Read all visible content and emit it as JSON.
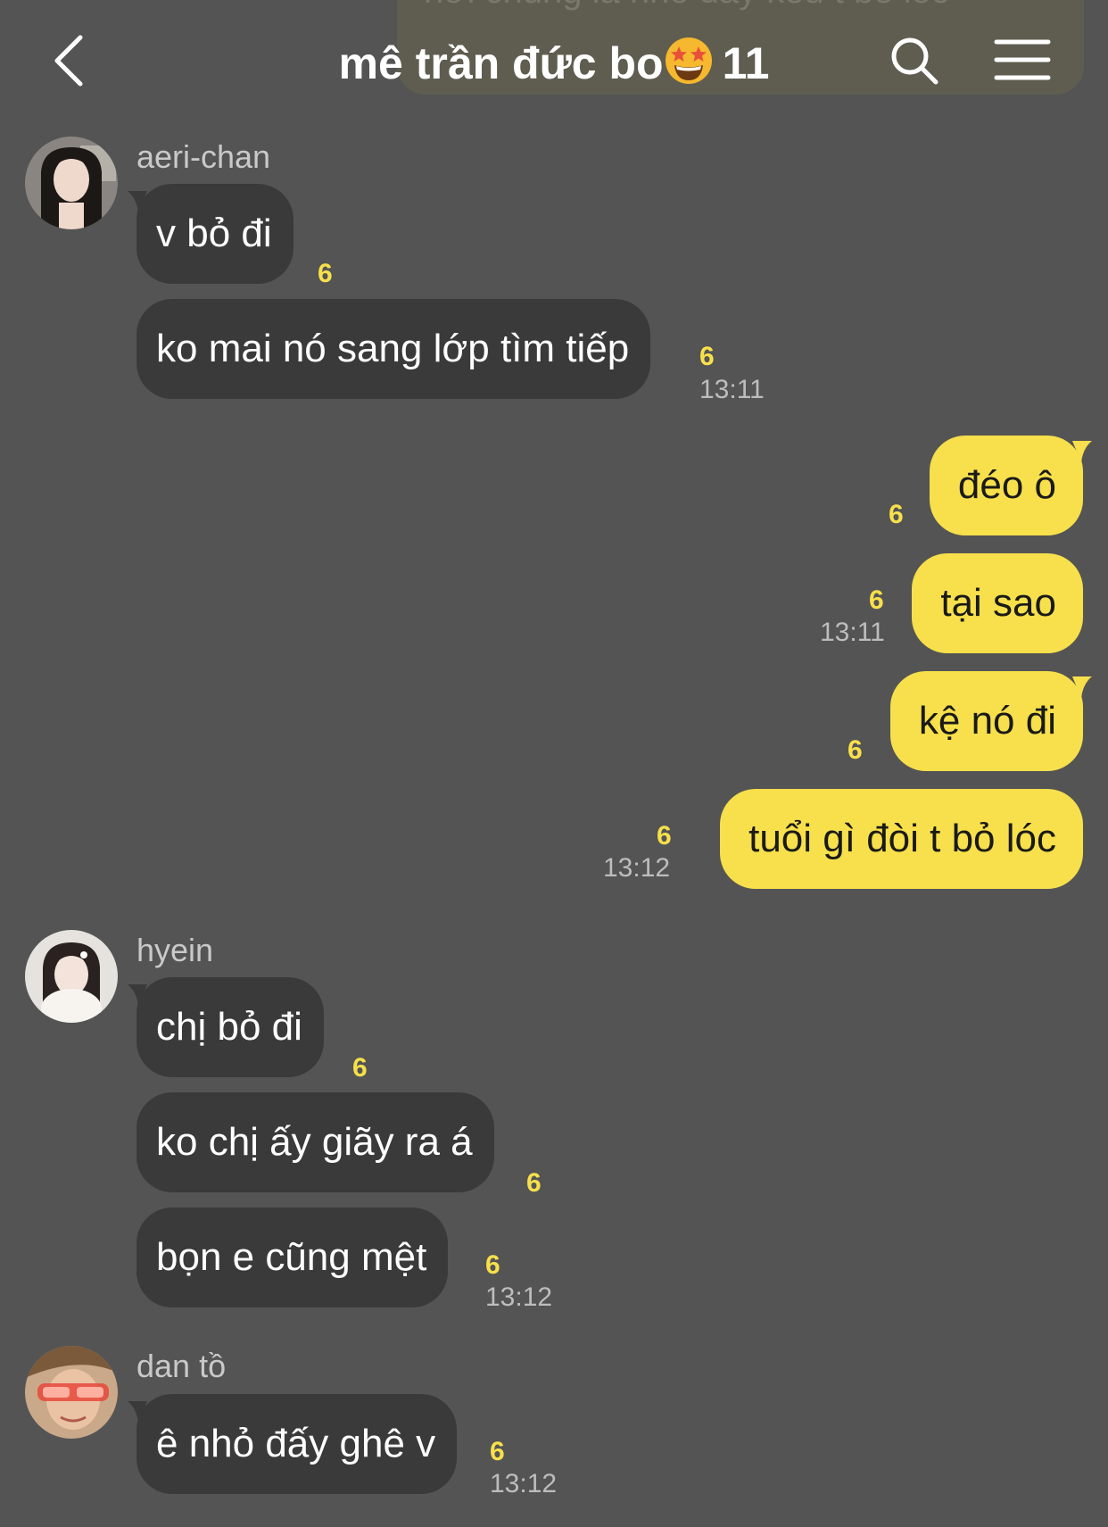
{
  "header": {
    "banner_peek": "hơi chúng là nhỏ đấy kêu t bỏ lóc",
    "title": "mê trần đức bo",
    "member_count": "11",
    "icons": [
      "back-icon",
      "star-struck-emoji",
      "search-icon",
      "menu-icon"
    ]
  },
  "messages": {
    "aeri": {
      "name": "aeri-chan",
      "m1": {
        "text": "v bỏ đi",
        "unread": "6"
      },
      "m2": {
        "text": "ko mai nó sang lớp tìm tiếp",
        "unread": "6",
        "time": "13:11"
      }
    },
    "me": {
      "m1": {
        "text": "đéo ô",
        "unread": "6"
      },
      "m2": {
        "text": "tại sao",
        "unread": "6",
        "time": "13:11"
      },
      "m3": {
        "text": "kệ nó đi",
        "unread": "6"
      },
      "m4": {
        "text": "tuổi gì đòi t bỏ lóc",
        "unread": "6",
        "time": "13:12"
      }
    },
    "hyein": {
      "name": "hyein",
      "m1": {
        "text": "chị bỏ đi",
        "unread": "6"
      },
      "m2": {
        "text": "ko chị ấy giãy ra á",
        "unread": "6"
      },
      "m3": {
        "text": "bọn e cũng mệt",
        "unread": "6",
        "time": "13:12"
      }
    },
    "dan": {
      "name": "dan tồ",
      "m1": {
        "text": "ê nhỏ đấy ghê v",
        "unread": "6",
        "time": "13:12"
      }
    }
  },
  "colors": {
    "background": "#545454",
    "incoming_bubble": "#3a3a3a",
    "outgoing_bubble": "#f7e04b",
    "unread_count": "#f7e04b"
  }
}
